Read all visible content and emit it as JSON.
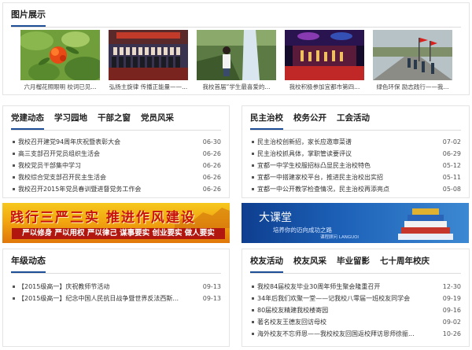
{
  "gallery_panel": {
    "title": "图片展示",
    "items": [
      {
        "caption": "六月榴花照眼明 校词已见..."
      },
      {
        "caption": "弘扬主旋律 传播正能量——..."
      },
      {
        "caption": "我校首届“学生最喜爱的..."
      },
      {
        "caption": "我校积极参加宜都市第四..."
      },
      {
        "caption": "绿色环保 励志践行——我..."
      }
    ]
  },
  "party_panel": {
    "tabs": [
      "党建动态",
      "学习园地",
      "干部之窗",
      "党员风采"
    ],
    "items": [
      {
        "title": "我校召开建党94周年庆祝暨表彰大会",
        "date": "06-30"
      },
      {
        "title": "高三支部召开党员组织生活会",
        "date": "06-26"
      },
      {
        "title": "我校党员干部集中学习",
        "date": "06-26"
      },
      {
        "title": "我校综合党支部召开民主生活会",
        "date": "06-26"
      },
      {
        "title": "我校召开2015年党员春训暨进督党务工作会",
        "date": "06-26"
      }
    ]
  },
  "democracy_panel": {
    "tabs": [
      "民主治校",
      "校务公开",
      "工会活动"
    ],
    "items": [
      {
        "title": "民主治校创新招，家长应邀审菜谱",
        "date": "07-02"
      },
      {
        "title": "民主治校抓具体，掌职管读要评议",
        "date": "06-29"
      },
      {
        "title": "宜都一中学生校服招标凸显民主治校特色",
        "date": "05-12"
      },
      {
        "title": "宜都一中搭建家校平台，推进民主治校出实招",
        "date": "05-11"
      },
      {
        "title": "宜都一中公开教学检查情况，民主治校再添亮点",
        "date": "05-08"
      }
    ]
  },
  "banners": {
    "left": {
      "line1": "践行三严三实 推进作风建设",
      "line2": "严以修身 严以用权 严以律己  谋事要实 创业要实 做人要实"
    },
    "right": {
      "line1": "大课堂",
      "line2": "培养你的迈向成功之路",
      "line3": "课程顾问 LANGUOI"
    }
  },
  "grade_panel": {
    "title": "年级动态",
    "items": [
      {
        "title": "【2015级高一】庆祝教师节活动",
        "date": "09-13"
      },
      {
        "title": "【2015级高一】纪念中国人民抗日战争暨世界反法西斯...",
        "date": "09-13"
      }
    ]
  },
  "alumni_panel": {
    "tabs": [
      "校友活动",
      "校友风采",
      "毕业留影",
      "七十周年校庆"
    ],
    "items": [
      {
        "title": "我校84届校友毕业30周年师生聚会隆重召开",
        "date": "12-30"
      },
      {
        "title": "34年后我们欢聚一堂——记我校八零届一班校友同学会",
        "date": "09-19"
      },
      {
        "title": "80届校友精建我校楼寄园",
        "date": "09-16"
      },
      {
        "title": "著名校友王德友回访母校",
        "date": "09-02"
      },
      {
        "title": "海外校友不忘师恩——我校校友回国返校拜访恩师徐振...",
        "date": "10-26"
      }
    ]
  },
  "colors": {
    "accent": "#1e4e96",
    "border": "#e4e4e4"
  }
}
